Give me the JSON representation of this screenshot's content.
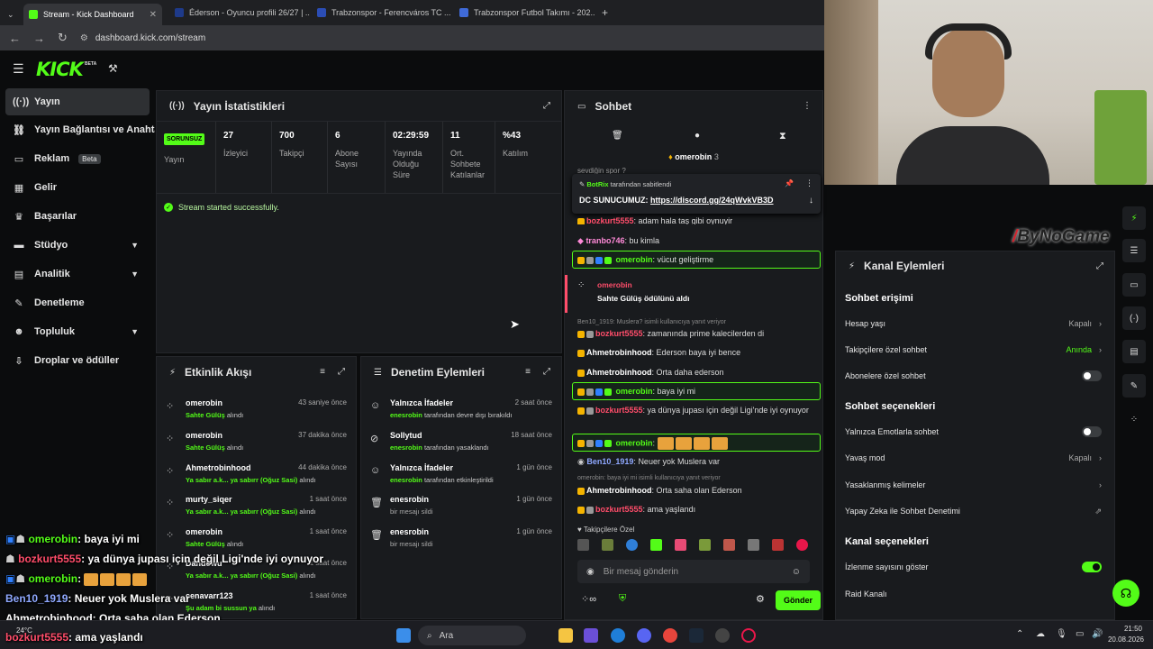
{
  "browser": {
    "tabs": [
      {
        "title": "Stream - Kick Dashboard",
        "color": "#53fc18"
      },
      {
        "title": "Éderson - Oyuncu profili 26/27 | ...",
        "color": "#1e3a8a"
      },
      {
        "title": "Trabzonspor - Ferencváros TC ...",
        "color": "#2b4db5"
      },
      {
        "title": "Trabzonspor Futbol Takımı - 202...",
        "color": "#3f6ad8"
      }
    ],
    "url": "dashboard.kick.com/stream"
  },
  "kick": {
    "logo": "KICK",
    "logo_sup": "BETA"
  },
  "sidebar": {
    "items": [
      {
        "label": "Yayın",
        "icon": "broadcast-icon"
      },
      {
        "label": "Yayın Bağlantısı ve Anahtarı",
        "icon": "link-icon"
      },
      {
        "label": "Reklam",
        "icon": "ad-icon",
        "badge": "Beta"
      },
      {
        "label": "Gelir",
        "icon": "revenue-icon"
      },
      {
        "label": "Başarılar",
        "icon": "trophy-icon"
      },
      {
        "label": "Stüdyo",
        "icon": "studio-icon"
      },
      {
        "label": "Analitik",
        "icon": "analytics-icon"
      },
      {
        "label": "Denetleme",
        "icon": "moderation-icon"
      },
      {
        "label": "Topluluk",
        "icon": "community-icon"
      },
      {
        "label": "Droplar ve ödüller",
        "icon": "drops-icon"
      }
    ]
  },
  "stats": {
    "title": "Yayın İstatistikleri",
    "badge": "SORUNSUZ",
    "status_label": "Yayın",
    "cols": [
      {
        "value": "27",
        "label": "İzleyici"
      },
      {
        "value": "700",
        "label": "Takipçi"
      },
      {
        "value": "6",
        "label": "Abone Sayısı"
      },
      {
        "value": "02:29:59",
        "label": "Yayında Olduğu Süre"
      },
      {
        "value": "11",
        "label": "Ort. Sohbete Katılanlar"
      },
      {
        "value": "%43",
        "label": "Katılım"
      }
    ],
    "message": "Stream started successfully."
  },
  "activity": {
    "title": "Etkinlik Akışı",
    "items": [
      {
        "name": "omerobin",
        "time": "43 saniye önce",
        "sub": "Sahte Gülüş",
        "sub2": "alındı"
      },
      {
        "name": "omerobin",
        "time": "37 dakika önce",
        "sub": "Sahte Gülüş",
        "sub2": "alındı"
      },
      {
        "name": "Ahmetrobinhood",
        "time": "44 dakika önce",
        "sub": "Ya sabır a.k... ya sabırr (Oğuz Sasi)",
        "sub2": "alındı"
      },
      {
        "name": "murty_siqer",
        "time": "1 saat önce",
        "sub": "Ya sabır a.k... ya sabırr (Oğuz Sasi)",
        "sub2": "alındı"
      },
      {
        "name": "omerobin",
        "time": "1 saat önce",
        "sub": "Sahte Gülüş",
        "sub2": "alındı"
      },
      {
        "name": "Dandowu",
        "time": "1 saat önce",
        "sub": "Ya sabır a.k... ya sabırr (Oğuz Sasi)",
        "sub2": "alındı"
      },
      {
        "name": "cenavarr123",
        "time": "1 saat önce",
        "sub": "Şu adam bi sussun ya",
        "sub2": "alındı"
      }
    ]
  },
  "moderation": {
    "title": "Denetim Eylemleri",
    "items": [
      {
        "name": "Yalnızca İfadeler",
        "time": "2 saat önce",
        "actor": "enesrobin",
        "sub": "tarafından devre dışı bırakıldı",
        "icon": "smile-icon"
      },
      {
        "name": "Sollytud",
        "time": "18 saat önce",
        "actor": "enesrobin",
        "sub": "tarafından yasaklandı",
        "icon": "ban-icon"
      },
      {
        "name": "Yalnızca İfadeler",
        "time": "1 gün önce",
        "actor": "enesrobin",
        "sub": "tarafından etkinleştirildi",
        "icon": "smile-icon"
      },
      {
        "name": "enesrobin",
        "time": "1 gün önce",
        "actor": "",
        "sub": "bir mesajı sildi",
        "icon": "trash-icon"
      },
      {
        "name": "enesrobin",
        "time": "1 gün önce",
        "actor": "",
        "sub": "bir mesajı sildi",
        "icon": "trash-icon"
      }
    ]
  },
  "chat": {
    "title": "Sohbet",
    "top_user": "omerobin",
    "top_count": "3",
    "cut_text": "sevdiğin spor ?",
    "pinned_by": "BotRix",
    "pinned_suffix": "tarafından sabitlendi",
    "pinned_label": "DC SUNUCUMUZ:",
    "pinned_link": "https://discord.gg/24qWvkVB3D",
    "messages": [
      {
        "user": "bozkurt5555",
        "color": "#ff4d6a",
        "text": "adam hala taş gibi oynuyir"
      },
      {
        "user": "tranbo746",
        "color": "#ff8ad8",
        "text": "bu kimla"
      },
      {
        "user": "omerobin",
        "color": "#53fc18",
        "text": "vücut geliştirme"
      },
      {
        "user": "Ahmetrobinhood",
        "color": "#ffffff",
        "text": "zamanında prime kalecilerden di",
        "reply": "Ben10_1919: Muslera? isimli kullanıcıya yanıt veriyor"
      },
      {
        "user": "Ahmetrobinhood",
        "color": "#ffffff",
        "text": "Ederson baya iyi bence"
      },
      {
        "user": "Ahmetrobinhood",
        "color": "#ffffff",
        "text": "Orta daha ederson"
      },
      {
        "user": "omerobin",
        "color": "#53fc18",
        "text": "baya iyi mi"
      },
      {
        "user": "bozkurt5555",
        "color": "#ff4d6a",
        "text": "ya dünya jupası için değil Ligi'nde iyi oynuyor"
      },
      {
        "user": "omerobin",
        "color": "#53fc18",
        "text": ""
      },
      {
        "user": "Ben10_1919",
        "color": "#8fa8ff",
        "text": "Neuer yok Muslera var"
      },
      {
        "user": "Ahmetrobinhood",
        "color": "#ffffff",
        "text": "Orta saha olan Ederson",
        "reply": "omerobin: baya iyi mi isimli kullanıcıya yanıt veriyor"
      },
      {
        "user": "bozkurt5555",
        "color": "#ff4d6a",
        "text": "ama yaşlandı"
      }
    ],
    "reward_user": "omerobin",
    "reward_text": "Sahte Gülüş ödülünü aldı",
    "bozkurt_first": "bozkurt5555",
    "followers_only": "Takipçilere Özel",
    "input_placeholder": "Bir mesaj gönderin",
    "send": "Gönder"
  },
  "channel": {
    "title": "Kanal Eylemleri",
    "sec1": "Sohbet erişimi",
    "age": "Hesap yaşı",
    "age_val": "Kapalı",
    "followers": "Takipçilere özel sohbet",
    "followers_val": "Anında",
    "subs": "Abonelere özel sohbet",
    "sec2": "Sohbet seçenekleri",
    "emote": "Yalnızca Emotlarla sohbet",
    "slow": "Yavaş mod",
    "slow_val": "Kapalı",
    "banned": "Yasaklanmış kelimeler",
    "ai": "Yapay Zeka ile Sohbet Denetimi",
    "sec3": "Kanal seçenekleri",
    "viewcount": "İzlenme sayısını göster",
    "raid": "Raid Kanalı"
  },
  "overlay": {
    "watermark": "ByNoGame",
    "lines": [
      {
        "user": "omerobin",
        "color": "#53fc18",
        "text": ": baya iyi mi"
      },
      {
        "user": "bozkurt5555",
        "color": "#ff4d6a",
        "text": ": ya dünya jupası için değil Ligi'nde iyi oynuyor"
      },
      {
        "user": "omerobin",
        "color": "#53fc18",
        "text": ":"
      },
      {
        "user": "Ben10_1919",
        "color": "#8fa8ff",
        "text": ": Neuer yok Muslera var"
      },
      {
        "user": "Ahmetrobinhood",
        "color": "#ffffff",
        "text": ": Orta saha olan Ederson"
      },
      {
        "user": "bozkurt5555",
        "color": "#ff4d6a",
        "text": ": ama yaşlandı"
      }
    ]
  },
  "taskbar": {
    "weather": "24°C",
    "search": "Ara",
    "time": "21:50",
    "date": "20.08.2026"
  }
}
